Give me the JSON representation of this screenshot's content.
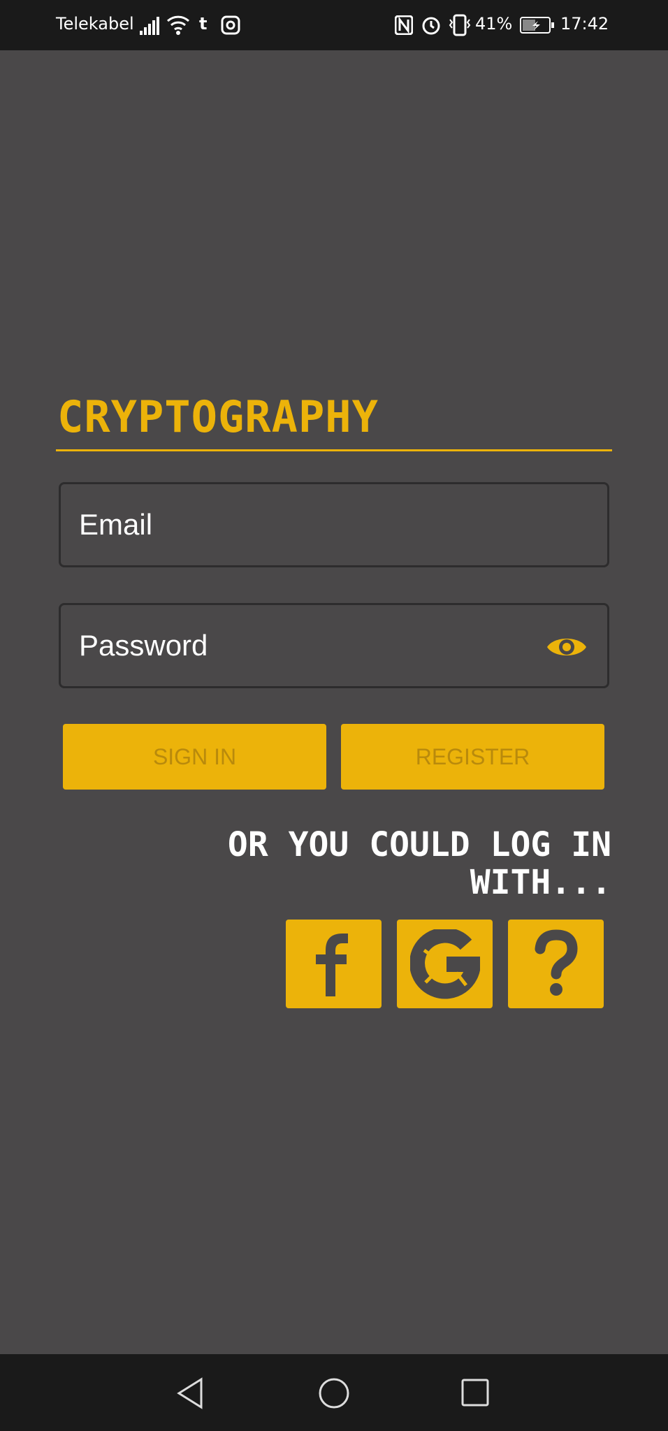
{
  "status_bar": {
    "carrier": "Telekabel",
    "battery": "41%",
    "time": "17:42"
  },
  "app": {
    "title": "CRYPTOGRAPHY"
  },
  "form": {
    "email_placeholder": "Email",
    "password_placeholder": "Password",
    "sign_in": "SIGN IN",
    "register": "REGISTER"
  },
  "social": {
    "prompt": "OR YOU COULD LOG IN WITH...",
    "options": [
      "facebook",
      "google",
      "help"
    ]
  },
  "colors": {
    "accent": "#ecb30a",
    "background": "#4a4849"
  }
}
